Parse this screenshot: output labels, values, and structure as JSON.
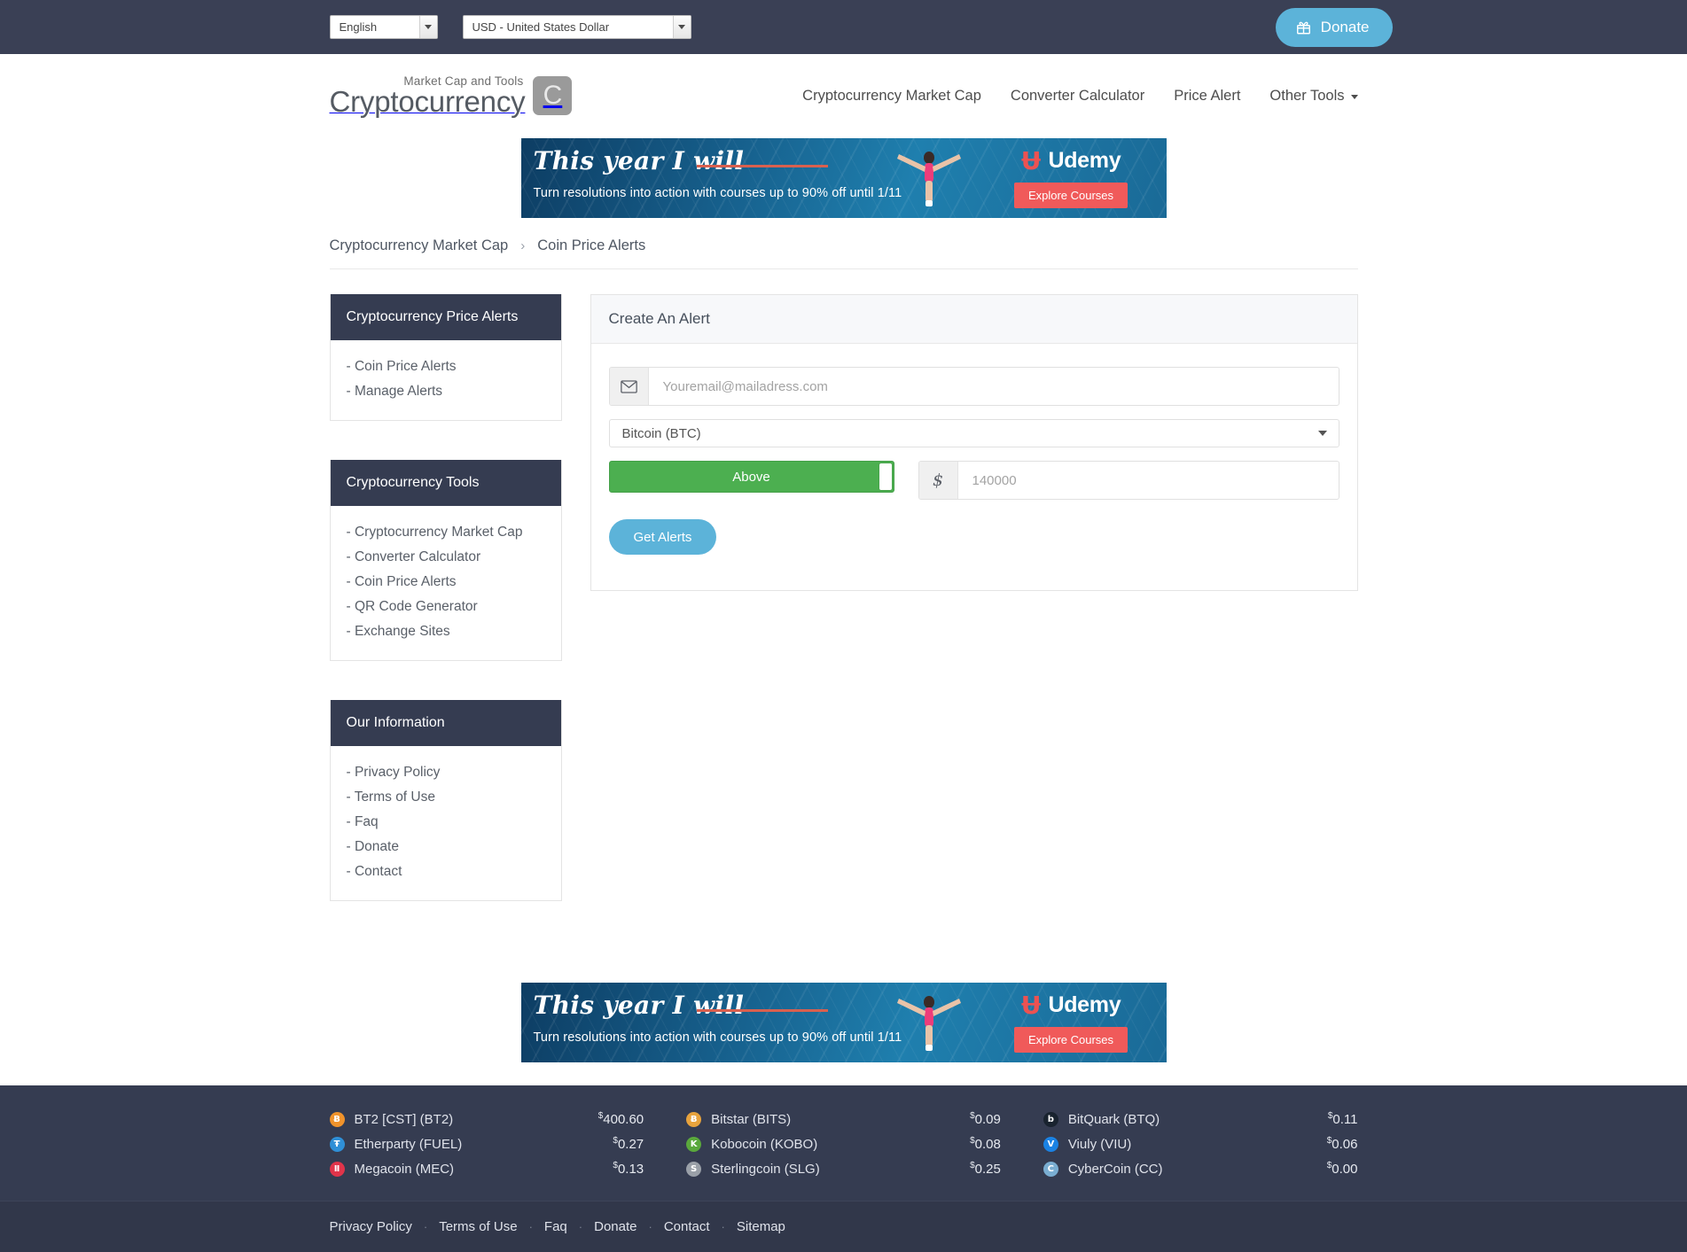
{
  "topbar": {
    "language": "English",
    "language_options": [
      "English"
    ],
    "currency": "USD - United States Dollar",
    "currency_options": [
      "USD - United States Dollar"
    ],
    "donate_label": "Donate",
    "donate_icon": "gift-icon",
    "bg_color": "#3a4055",
    "donate_color": "#5cb3d9"
  },
  "header": {
    "logo_sub": "Market Cap and Tools",
    "logo_main": "Cryptocurrency",
    "logo_badge": "C",
    "nav": [
      {
        "label": "Cryptocurrency Market Cap"
      },
      {
        "label": "Converter Calculator"
      },
      {
        "label": "Price Alert"
      },
      {
        "label": "Other Tools"
      }
    ]
  },
  "ad": {
    "headline": "This year I will",
    "subline": "Turn resolutions into action with courses up to 90% off until 1/11",
    "brand_mark": "Ʉ",
    "brand": "Udemy",
    "cta": "Explore Courses"
  },
  "breadcrumb": {
    "parent": "Cryptocurrency Market Cap",
    "separator": "›",
    "current": "Coin Price Alerts"
  },
  "sidebar": {
    "panels": [
      {
        "title": "Cryptocurrency Price Alerts",
        "items": [
          "- Coin Price Alerts",
          "- Manage Alerts"
        ]
      },
      {
        "title": "Cryptocurrency Tools",
        "items": [
          "- Cryptocurrency Market Cap",
          "- Converter Calculator",
          "- Coin Price Alerts",
          "- QR Code Generator",
          "- Exchange Sites"
        ]
      },
      {
        "title": "Our Information",
        "items": [
          "- Privacy Policy",
          "- Terms of Use",
          "- Faq",
          "- Donate",
          "- Contact"
        ]
      }
    ]
  },
  "alert_form": {
    "card_title": "Create An Alert",
    "email_placeholder": "Youremail@mailadress.com",
    "email_value": "",
    "email_icon": "envelope-icon",
    "coin_selected": "Bitcoin (BTC)",
    "coin_options": [
      "Bitcoin (BTC)"
    ],
    "direction_label": "Above",
    "direction_color": "#4caf50",
    "currency_symbol": "$",
    "price_placeholder": "140000",
    "price_value": "",
    "submit_label": "Get Alerts",
    "submit_color": "#5cb3d9"
  },
  "footer": {
    "ticker_columns": [
      [
        {
          "name": "BT2 [CST] (BT2)",
          "price": "400.60",
          "symbol": "$",
          "icon_letter": "Ƀ",
          "icon_color": "#f0932b"
        },
        {
          "name": "Etherparty (FUEL)",
          "price": "0.27",
          "symbol": "$",
          "icon_letter": "Ŧ",
          "icon_color": "#2f8fd6"
        },
        {
          "name": "Megacoin (MEC)",
          "price": "0.13",
          "symbol": "$",
          "icon_letter": "Ⅱ",
          "icon_color": "#e0344a"
        }
      ],
      [
        {
          "name": "Bitstar (BITS)",
          "price": "0.09",
          "symbol": "$",
          "icon_letter": "Ƀ",
          "icon_color": "#e8a33d"
        },
        {
          "name": "Kobocoin (KOBO)",
          "price": "0.08",
          "symbol": "$",
          "icon_letter": "K",
          "icon_color": "#5aa83c"
        },
        {
          "name": "Sterlingcoin (SLG)",
          "price": "0.25",
          "symbol": "$",
          "icon_letter": "S",
          "icon_color": "#9aa0a8"
        }
      ],
      [
        {
          "name": "BitQuark (BTQ)",
          "price": "0.11",
          "symbol": "$",
          "icon_letter": "b",
          "icon_color": "#19232f"
        },
        {
          "name": "Viuly (VIU)",
          "price": "0.06",
          "symbol": "$",
          "icon_letter": "V",
          "icon_color": "#1b82e3"
        },
        {
          "name": "CyberCoin (CC)",
          "price": "0.00",
          "symbol": "$",
          "icon_letter": "C",
          "icon_color": "#7aaed2"
        }
      ]
    ],
    "links": [
      "Privacy Policy",
      "Terms of Use",
      "Faq",
      "Donate",
      "Contact",
      "Sitemap"
    ],
    "link_separator": "·",
    "bg_color": "#353c51"
  }
}
